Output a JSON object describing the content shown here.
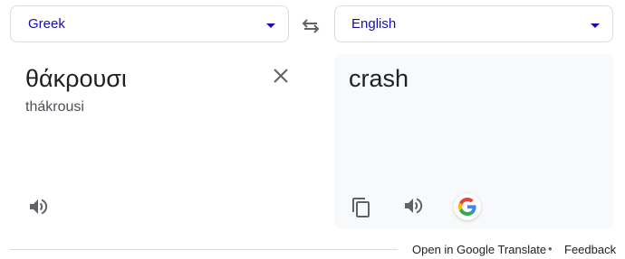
{
  "source_language": {
    "label": "Greek",
    "icon": "chevron-down-icon"
  },
  "target_language": {
    "label": "English",
    "icon": "chevron-down-icon"
  },
  "swap": {
    "icon": "swap-arrows-icon"
  },
  "source": {
    "text": "θάκρουσι",
    "transliteration": "thákrousi",
    "clear_icon": "close-icon",
    "speaker_icon": "speaker-icon"
  },
  "target": {
    "text": "crash",
    "copy_icon": "copy-icon",
    "speaker_icon": "speaker-icon",
    "google_icon": "google-logo-icon"
  },
  "footer": {
    "open_link": "Open in Google Translate",
    "separator": "•",
    "feedback_link": "Feedback"
  },
  "colors": {
    "language_label": "#1a0dab",
    "target_panel_bg": "#f8f9fa",
    "border": "#dadce0",
    "icon": "#5f6368",
    "text": "#202124"
  }
}
